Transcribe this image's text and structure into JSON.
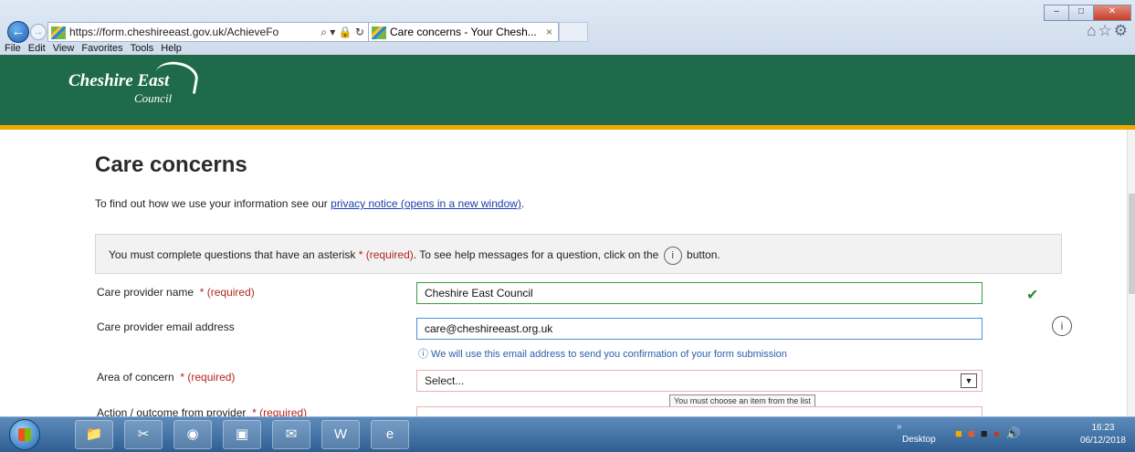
{
  "browser": {
    "url": "https://form.cheshireeast.gov.uk/AchieveFo",
    "address_tools": "⌕ ▾ 🔒 ↻",
    "tab_title": "Care concerns - Your Chesh...",
    "tab_close": "×",
    "window_controls": {
      "minimize": "–",
      "maximize": "□",
      "close": "✕"
    },
    "menu": [
      "File",
      "Edit",
      "View",
      "Favorites",
      "Tools",
      "Help"
    ],
    "icons": [
      "home-icon",
      "star-icon",
      "gear-icon"
    ]
  },
  "site": {
    "logo_main": "Cheshire East",
    "logo_sub": "Council",
    "header_color": "#1e6a4a",
    "accent_color": "#f0a800"
  },
  "form": {
    "title": "Care concerns",
    "privacy_prefix": "To find out how we use your information see our ",
    "privacy_link": "privacy notice (opens in a new window)",
    "privacy_suffix": ".",
    "info_part1": "You must complete questions that have an asterisk ",
    "info_required": "* (required)",
    "info_part2": ". To see help messages for a question, click on the ",
    "info_icon": "i",
    "info_part3": " button.",
    "fields": {
      "provider_name": {
        "label": "Care provider name",
        "required": "* (required)",
        "value": "Cheshire East Council",
        "valid_mark": "✔"
      },
      "email": {
        "label": "Care provider email address",
        "value": "care@cheshireeast.org.uk",
        "help": "ⓘ  We will use this email address to send you confirmation of your form submission",
        "info_icon": "i"
      },
      "area": {
        "label": "Area of concern",
        "required": "* (required)",
        "value": "Select...",
        "error_tooltip": "You must choose an item from the list"
      },
      "action": {
        "label": "Action / outcome from provider",
        "required": "* (required)"
      }
    }
  },
  "taskbar": {
    "apps": [
      "explorer-folder",
      "snipping-tool",
      "chrome",
      "remote-desktop",
      "outlook",
      "word",
      "internet-explorer"
    ],
    "desktop_label": "Desktop",
    "desktop_chevron": "»",
    "time": "16:23",
    "date": "06/12/2018"
  }
}
